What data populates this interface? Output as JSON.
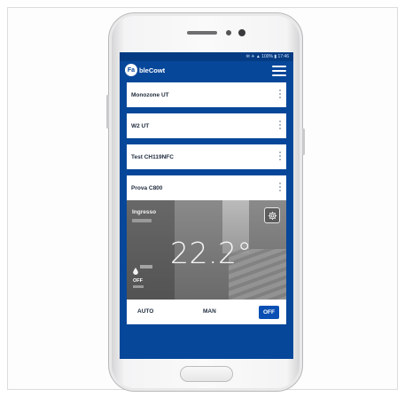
{
  "status_bar": {
    "text": "✉ ✈ ▲ 100% ▮ 17:46"
  },
  "app": {
    "logo_initials": "Fa",
    "logo_text": "bleCowt"
  },
  "devices": [
    {
      "label": "Monozone UT"
    },
    {
      "label": "W2 UT"
    },
    {
      "label": "Test CH119NFC"
    },
    {
      "label": "Prova C800"
    }
  ],
  "thermostat": {
    "room_name": "Ingresso",
    "temperature": "22.2°",
    "mode_label": "OFF"
  },
  "modes": {
    "auto": "AUTO",
    "man": "MAN",
    "off": "OFF",
    "selected": "OFF"
  },
  "colors": {
    "primary": "#07479a",
    "accent": "#0a4fb3"
  }
}
